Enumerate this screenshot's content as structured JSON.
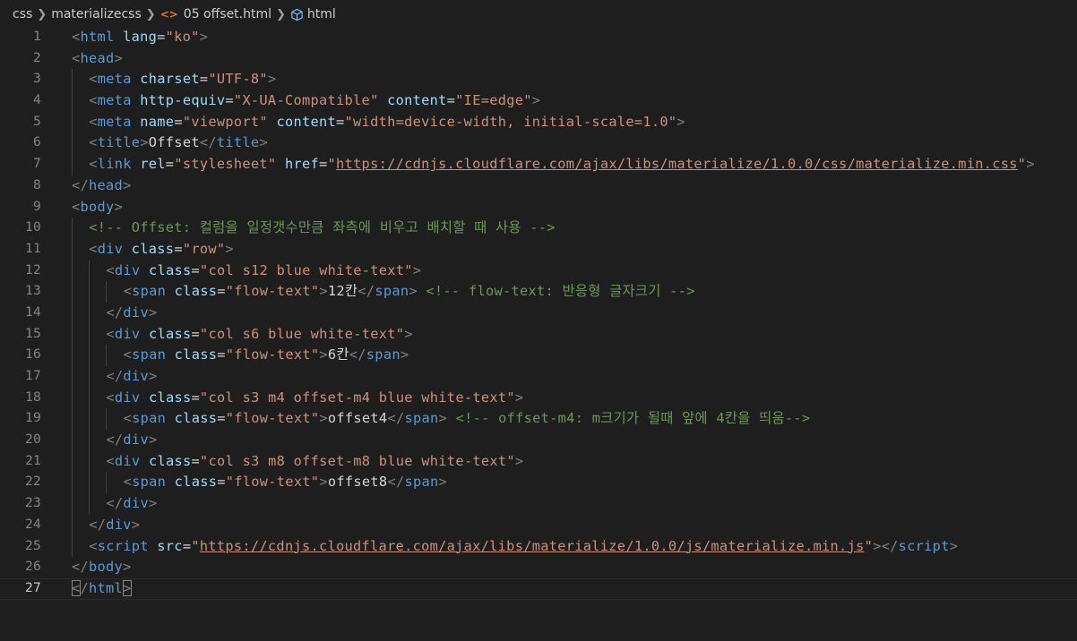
{
  "breadcrumb": {
    "items": [
      "css",
      "materializecss",
      "05 offset.html",
      "html"
    ],
    "file_icon": "html-file-icon",
    "element_icon": "symbol-element-icon"
  },
  "colors": {
    "background": "#1e1e1e",
    "tag": "#569cd6",
    "attribute": "#9cdcfe",
    "string": "#ce9178",
    "comment": "#6a9955",
    "punctuation": "#808080",
    "text": "#d4d4d4"
  },
  "editor": {
    "current_line": 27,
    "lines": [
      {
        "n": "1",
        "indent": 0,
        "tokens": [
          [
            "p",
            "<"
          ],
          [
            "tag",
            "html"
          ],
          [
            "txt",
            " "
          ],
          [
            "attr",
            "lang"
          ],
          [
            "txt",
            "="
          ],
          [
            "str",
            "\"ko\""
          ],
          [
            "p",
            ">"
          ]
        ]
      },
      {
        "n": "2",
        "indent": 0,
        "tokens": [
          [
            "p",
            "<"
          ],
          [
            "tag",
            "head"
          ],
          [
            "p",
            ">"
          ]
        ]
      },
      {
        "n": "3",
        "indent": 1,
        "tokens": [
          [
            "p",
            "<"
          ],
          [
            "tag",
            "meta"
          ],
          [
            "txt",
            " "
          ],
          [
            "attr",
            "charset"
          ],
          [
            "txt",
            "="
          ],
          [
            "str",
            "\"UTF-8\""
          ],
          [
            "p",
            ">"
          ]
        ]
      },
      {
        "n": "4",
        "indent": 1,
        "tokens": [
          [
            "p",
            "<"
          ],
          [
            "tag",
            "meta"
          ],
          [
            "txt",
            " "
          ],
          [
            "attr",
            "http-equiv"
          ],
          [
            "txt",
            "="
          ],
          [
            "str",
            "\"X-UA-Compatible\""
          ],
          [
            "txt",
            " "
          ],
          [
            "attr",
            "content"
          ],
          [
            "txt",
            "="
          ],
          [
            "str",
            "\"IE=edge\""
          ],
          [
            "p",
            ">"
          ]
        ]
      },
      {
        "n": "5",
        "indent": 1,
        "tokens": [
          [
            "p",
            "<"
          ],
          [
            "tag",
            "meta"
          ],
          [
            "txt",
            " "
          ],
          [
            "attr",
            "name"
          ],
          [
            "txt",
            "="
          ],
          [
            "str",
            "\"viewport\""
          ],
          [
            "txt",
            " "
          ],
          [
            "attr",
            "content"
          ],
          [
            "txt",
            "="
          ],
          [
            "str",
            "\"width=device-width, initial-scale=1.0\""
          ],
          [
            "p",
            ">"
          ]
        ]
      },
      {
        "n": "6",
        "indent": 1,
        "tokens": [
          [
            "p",
            "<"
          ],
          [
            "tag",
            "title"
          ],
          [
            "p",
            ">"
          ],
          [
            "txt",
            "Offset"
          ],
          [
            "p",
            "</"
          ],
          [
            "tag",
            "title"
          ],
          [
            "p",
            ">"
          ]
        ]
      },
      {
        "n": "7",
        "indent": 1,
        "tokens": [
          [
            "p",
            "<"
          ],
          [
            "tag",
            "link"
          ],
          [
            "txt",
            " "
          ],
          [
            "attr",
            "rel"
          ],
          [
            "txt",
            "="
          ],
          [
            "str",
            "\"stylesheet\""
          ],
          [
            "txt",
            " "
          ],
          [
            "attr",
            "href"
          ],
          [
            "txt",
            "="
          ],
          [
            "str",
            "\""
          ],
          [
            "url",
            "https://cdnjs.cloudflare.com/ajax/libs/materialize/1.0.0/css/materialize.min.css"
          ],
          [
            "str",
            "\""
          ],
          [
            "p",
            ">"
          ]
        ]
      },
      {
        "n": "8",
        "indent": 0,
        "tokens": [
          [
            "p",
            "</"
          ],
          [
            "tag",
            "head"
          ],
          [
            "p",
            ">"
          ]
        ]
      },
      {
        "n": "9",
        "indent": 0,
        "tokens": [
          [
            "p",
            "<"
          ],
          [
            "tag",
            "body"
          ],
          [
            "p",
            ">"
          ]
        ]
      },
      {
        "n": "10",
        "indent": 1,
        "tokens": [
          [
            "com",
            "<!-- Offset: 컬럼을 일정갯수만큼 좌측에 비우고 배치할 때 사용 -->"
          ]
        ]
      },
      {
        "n": "11",
        "indent": 1,
        "tokens": [
          [
            "p",
            "<"
          ],
          [
            "tag",
            "div"
          ],
          [
            "txt",
            " "
          ],
          [
            "attr",
            "class"
          ],
          [
            "txt",
            "="
          ],
          [
            "str",
            "\"row\""
          ],
          [
            "p",
            ">"
          ]
        ]
      },
      {
        "n": "12",
        "indent": 2,
        "tokens": [
          [
            "p",
            "<"
          ],
          [
            "tag",
            "div"
          ],
          [
            "txt",
            " "
          ],
          [
            "attr",
            "class"
          ],
          [
            "txt",
            "="
          ],
          [
            "str",
            "\"col s12 blue white-text\""
          ],
          [
            "p",
            ">"
          ]
        ]
      },
      {
        "n": "13",
        "indent": 3,
        "tokens": [
          [
            "p",
            "<"
          ],
          [
            "tag",
            "span"
          ],
          [
            "txt",
            " "
          ],
          [
            "attr",
            "class"
          ],
          [
            "txt",
            "="
          ],
          [
            "str",
            "\"flow-text\""
          ],
          [
            "p",
            ">"
          ],
          [
            "txt",
            "12칸"
          ],
          [
            "p",
            "</"
          ],
          [
            "tag",
            "span"
          ],
          [
            "p",
            ">"
          ],
          [
            "txt",
            " "
          ],
          [
            "com",
            "<!-- flow-text: 반응형 글자크기 -->"
          ]
        ]
      },
      {
        "n": "14",
        "indent": 2,
        "tokens": [
          [
            "p",
            "</"
          ],
          [
            "tag",
            "div"
          ],
          [
            "p",
            ">"
          ]
        ]
      },
      {
        "n": "15",
        "indent": 2,
        "tokens": [
          [
            "p",
            "<"
          ],
          [
            "tag",
            "div"
          ],
          [
            "txt",
            " "
          ],
          [
            "attr",
            "class"
          ],
          [
            "txt",
            "="
          ],
          [
            "str",
            "\"col s6 blue white-text\""
          ],
          [
            "p",
            ">"
          ]
        ]
      },
      {
        "n": "16",
        "indent": 3,
        "tokens": [
          [
            "p",
            "<"
          ],
          [
            "tag",
            "span"
          ],
          [
            "txt",
            " "
          ],
          [
            "attr",
            "class"
          ],
          [
            "txt",
            "="
          ],
          [
            "str",
            "\"flow-text\""
          ],
          [
            "p",
            ">"
          ],
          [
            "txt",
            "6칸"
          ],
          [
            "p",
            "</"
          ],
          [
            "tag",
            "span"
          ],
          [
            "p",
            ">"
          ]
        ]
      },
      {
        "n": "17",
        "indent": 2,
        "tokens": [
          [
            "p",
            "</"
          ],
          [
            "tag",
            "div"
          ],
          [
            "p",
            ">"
          ]
        ]
      },
      {
        "n": "18",
        "indent": 2,
        "tokens": [
          [
            "p",
            "<"
          ],
          [
            "tag",
            "div"
          ],
          [
            "txt",
            " "
          ],
          [
            "attr",
            "class"
          ],
          [
            "txt",
            "="
          ],
          [
            "str",
            "\"col s3 m4 offset-m4 blue white-text\""
          ],
          [
            "p",
            ">"
          ]
        ]
      },
      {
        "n": "19",
        "indent": 3,
        "tokens": [
          [
            "p",
            "<"
          ],
          [
            "tag",
            "span"
          ],
          [
            "txt",
            " "
          ],
          [
            "attr",
            "class"
          ],
          [
            "txt",
            "="
          ],
          [
            "str",
            "\"flow-text\""
          ],
          [
            "p",
            ">"
          ],
          [
            "txt",
            "offset4"
          ],
          [
            "p",
            "</"
          ],
          [
            "tag",
            "span"
          ],
          [
            "p",
            ">"
          ],
          [
            "txt",
            " "
          ],
          [
            "com",
            "<!-- offset-m4: m크기가 될때 앞에 4칸을 띄움-->"
          ]
        ]
      },
      {
        "n": "20",
        "indent": 2,
        "tokens": [
          [
            "p",
            "</"
          ],
          [
            "tag",
            "div"
          ],
          [
            "p",
            ">"
          ]
        ]
      },
      {
        "n": "21",
        "indent": 2,
        "tokens": [
          [
            "p",
            "<"
          ],
          [
            "tag",
            "div"
          ],
          [
            "txt",
            " "
          ],
          [
            "attr",
            "class"
          ],
          [
            "txt",
            "="
          ],
          [
            "str",
            "\"col s3 m8 offset-m8 blue white-text\""
          ],
          [
            "p",
            ">"
          ]
        ]
      },
      {
        "n": "22",
        "indent": 3,
        "tokens": [
          [
            "p",
            "<"
          ],
          [
            "tag",
            "span"
          ],
          [
            "txt",
            " "
          ],
          [
            "attr",
            "class"
          ],
          [
            "txt",
            "="
          ],
          [
            "str",
            "\"flow-text\""
          ],
          [
            "p",
            ">"
          ],
          [
            "txt",
            "offset8"
          ],
          [
            "p",
            "</"
          ],
          [
            "tag",
            "span"
          ],
          [
            "p",
            ">"
          ]
        ]
      },
      {
        "n": "23",
        "indent": 2,
        "tokens": [
          [
            "p",
            "</"
          ],
          [
            "tag",
            "div"
          ],
          [
            "p",
            ">"
          ]
        ]
      },
      {
        "n": "24",
        "indent": 1,
        "tokens": [
          [
            "p",
            "</"
          ],
          [
            "tag",
            "div"
          ],
          [
            "p",
            ">"
          ]
        ]
      },
      {
        "n": "25",
        "indent": 1,
        "tokens": [
          [
            "p",
            "<"
          ],
          [
            "tag",
            "script"
          ],
          [
            "txt",
            " "
          ],
          [
            "attr",
            "src"
          ],
          [
            "txt",
            "="
          ],
          [
            "str",
            "\""
          ],
          [
            "url",
            "https://cdnjs.cloudflare.com/ajax/libs/materialize/1.0.0/js/materialize.min.js"
          ],
          [
            "str",
            "\""
          ],
          [
            "p",
            "></"
          ],
          [
            "tag",
            "script"
          ],
          [
            "p",
            ">"
          ]
        ]
      },
      {
        "n": "26",
        "indent": 0,
        "tokens": [
          [
            "p",
            "</"
          ],
          [
            "tag",
            "body"
          ],
          [
            "p",
            ">"
          ]
        ]
      },
      {
        "n": "27",
        "indent": 0,
        "tokens": [
          [
            "bm",
            "<"
          ],
          [
            "p",
            "/"
          ],
          [
            "tag",
            "html"
          ],
          [
            "bm",
            ">"
          ]
        ]
      }
    ]
  }
}
